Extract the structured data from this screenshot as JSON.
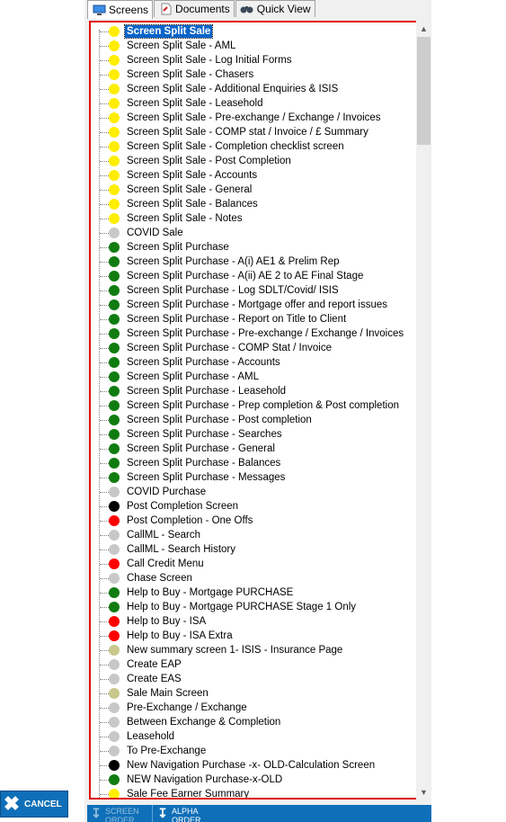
{
  "tabs": [
    {
      "label": "Screens",
      "icon": "monitor-icon",
      "active": true
    },
    {
      "label": "Documents",
      "icon": "document-icon",
      "active": false
    },
    {
      "label": "Quick View",
      "icon": "binoculars-icon",
      "active": false
    }
  ],
  "status_colors": {
    "yellow": "#ffee00",
    "green": "#107c10",
    "gray": "#c8c8c8",
    "black": "#000000",
    "red": "#ff0000",
    "olive": "#c8c88c"
  },
  "items": [
    {
      "label": "Screen Split Sale",
      "color": "yellow",
      "selected": true
    },
    {
      "label": "Screen Split Sale - AML",
      "color": "yellow"
    },
    {
      "label": "Screen Split Sale - Log Initial Forms",
      "color": "yellow"
    },
    {
      "label": "Screen Split Sale - Chasers",
      "color": "yellow"
    },
    {
      "label": "Screen Split Sale - Additional Enquiries & ISIS",
      "color": "yellow"
    },
    {
      "label": "Screen Split Sale - Leasehold",
      "color": "yellow"
    },
    {
      "label": "Screen Split Sale - Pre-exchange / Exchange / Invoices",
      "color": "yellow"
    },
    {
      "label": "Screen Split Sale - COMP stat / Invoice / £ Summary",
      "color": "yellow"
    },
    {
      "label": "Screen Split Sale - Completion checklist screen",
      "color": "yellow"
    },
    {
      "label": "Screen Split Sale - Post Completion",
      "color": "yellow"
    },
    {
      "label": "Screen Split Sale - Accounts",
      "color": "yellow"
    },
    {
      "label": "Screen Split Sale - General",
      "color": "yellow"
    },
    {
      "label": "Screen Split Sale - Balances",
      "color": "yellow"
    },
    {
      "label": "Screen Split Sale - Notes",
      "color": "yellow"
    },
    {
      "label": "COVID Sale",
      "color": "gray"
    },
    {
      "label": "Screen Split Purchase",
      "color": "green"
    },
    {
      "label": "Screen Split Purchase - A(i) AE1 & Prelim Rep",
      "color": "green"
    },
    {
      "label": "Screen Split Purchase - A(ii) AE 2 to AE Final Stage",
      "color": "green"
    },
    {
      "label": "Screen Split Purchase - Log SDLT/Covid/ ISIS",
      "color": "green"
    },
    {
      "label": "Screen Split Purchase - Mortgage offer and report issues",
      "color": "green"
    },
    {
      "label": "Screen Split Purchase - Report on Title to Client",
      "color": "green"
    },
    {
      "label": "Screen Split Purchase - Pre-exchange / Exchange / Invoices",
      "color": "green"
    },
    {
      "label": "Screen Split Purchase - COMP Stat / Invoice",
      "color": "green"
    },
    {
      "label": "Screen Split Purchase - Accounts",
      "color": "green"
    },
    {
      "label": "Screen Split Purchase - AML",
      "color": "green"
    },
    {
      "label": "Screen Split Purchase - Leasehold",
      "color": "green"
    },
    {
      "label": "Screen Split Purchase - Prep completion & Post completion",
      "color": "green"
    },
    {
      "label": "Screen Split Purchase - Post completion",
      "color": "green"
    },
    {
      "label": "Screen Split Purchase - Searches",
      "color": "green"
    },
    {
      "label": "Screen Split Purchase - General",
      "color": "green"
    },
    {
      "label": "Screen Split Purchase - Balances",
      "color": "green"
    },
    {
      "label": "Screen Split Purchase - Messages",
      "color": "green"
    },
    {
      "label": "COVID Purchase",
      "color": "gray"
    },
    {
      "label": "Post Completion Screen",
      "color": "black"
    },
    {
      "label": "Post Completion - One Offs",
      "color": "red"
    },
    {
      "label": "CallML - Search",
      "color": "gray"
    },
    {
      "label": "CallML - Search History",
      "color": "gray"
    },
    {
      "label": "Call Credit Menu",
      "color": "red"
    },
    {
      "label": "Chase Screen",
      "color": "gray"
    },
    {
      "label": "Help to Buy - Mortgage PURCHASE",
      "color": "green"
    },
    {
      "label": "Help to Buy - Mortgage PURCHASE Stage 1 Only",
      "color": "green"
    },
    {
      "label": "Help to Buy - ISA",
      "color": "red"
    },
    {
      "label": "Help to Buy - ISA Extra",
      "color": "red"
    },
    {
      "label": "New summary screen 1- ISIS - Insurance Page",
      "color": "olive"
    },
    {
      "label": "Create EAP",
      "color": "gray"
    },
    {
      "label": "Create EAS",
      "color": "gray"
    },
    {
      "label": "Sale Main Screen",
      "color": "olive"
    },
    {
      "label": "Pre-Exchange / Exchange",
      "color": "gray"
    },
    {
      "label": "Between Exchange & Completion",
      "color": "gray"
    },
    {
      "label": "Leasehold",
      "color": "gray"
    },
    {
      "label": "To Pre-Exchange",
      "color": "gray"
    },
    {
      "label": "New Navigation Purchase -x- OLD-Calculation Screen",
      "color": "black"
    },
    {
      "label": "NEW Navigation Purchase-x-OLD",
      "color": "green"
    },
    {
      "label": "Sale Fee Earner Summary",
      "color": "yellow"
    }
  ],
  "cancel_button": {
    "label": "CANCEL"
  },
  "sort_buttons": [
    {
      "label": "SCREEN ORDER",
      "enabled": false
    },
    {
      "label": "ALPHA ORDER",
      "enabled": true
    }
  ]
}
